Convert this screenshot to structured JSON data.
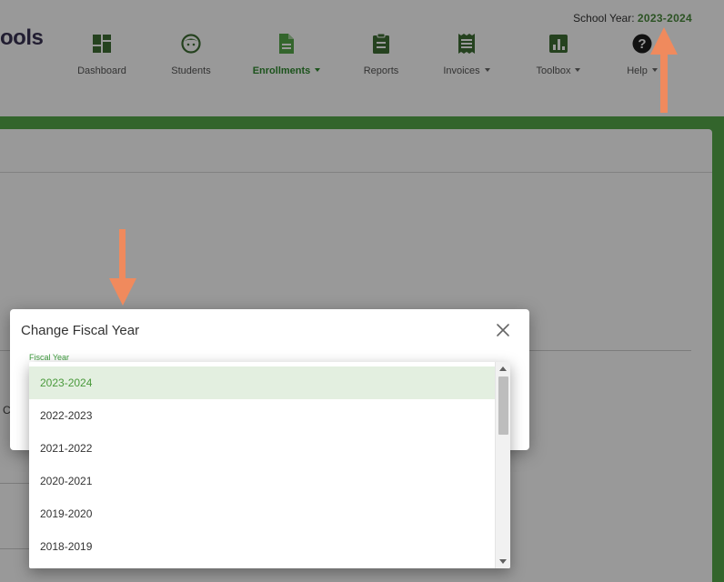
{
  "header": {
    "logo_fragment": "ools",
    "school_year_label": "School Year:",
    "school_year_value": "2023-2024"
  },
  "nav": [
    {
      "label": "Dashboard",
      "icon": "dashboard-icon",
      "dropdown": false,
      "active": false
    },
    {
      "label": "Students",
      "icon": "student-face-icon",
      "dropdown": false,
      "active": false
    },
    {
      "label": "Enrollments",
      "icon": "document-icon",
      "dropdown": true,
      "active": true
    },
    {
      "label": "Reports",
      "icon": "clipboard-icon",
      "dropdown": false,
      "active": false
    },
    {
      "label": "Invoices",
      "icon": "receipt-icon",
      "dropdown": true,
      "active": false
    },
    {
      "label": "Toolbox",
      "icon": "bar-chart-icon",
      "dropdown": true,
      "active": false
    },
    {
      "label": "Help",
      "icon": "help-icon",
      "dropdown": true,
      "active": false
    }
  ],
  "page": {
    "partial_text": "C"
  },
  "modal": {
    "title": "Change Fiscal Year",
    "field_label": "Fiscal Year",
    "selected_value": "2023-2024",
    "options": [
      "2023-2024",
      "2022-2023",
      "2021-2022",
      "2020-2021",
      "2019-2020",
      "2018-2019"
    ]
  },
  "colors": {
    "brand_green": "#55a84a",
    "nav_icon_green": "#3f6f34",
    "active_green": "#2f8a2f",
    "selected_option_bg": "#e3efe0",
    "annotation_arrow": "#f08a5d"
  }
}
